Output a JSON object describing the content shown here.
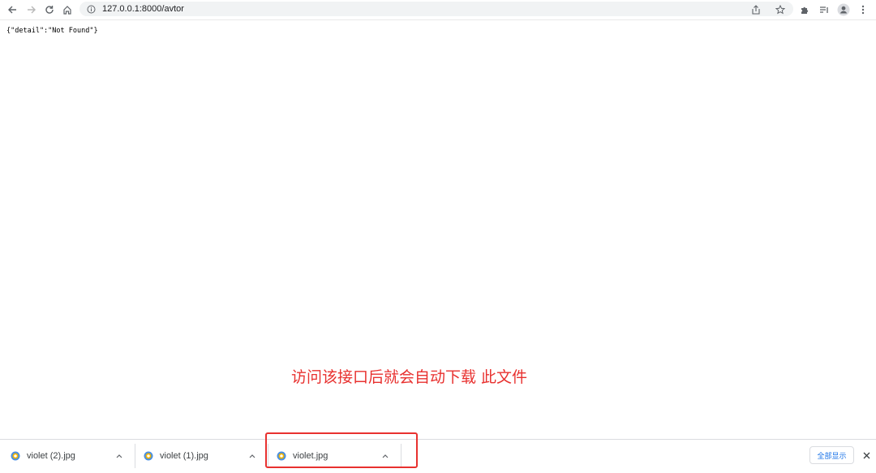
{
  "toolbar": {
    "back_icon": "arrow-left-icon",
    "forward_icon": "arrow-right-icon",
    "reload_icon": "reload-icon",
    "home_icon": "home-icon",
    "url": "127.0.0.1:8000/avtor",
    "right_icons": [
      "share-icon",
      "star-icon",
      "extensions-icon",
      "reading-list-icon",
      "profile-icon",
      "menu-icon"
    ]
  },
  "page": {
    "body_text": "{\"detail\":\"Not Found\"}"
  },
  "annotation": {
    "text": "访问该接口后就会自动下载 此文件",
    "color": "#e8312f"
  },
  "downloads": {
    "items": [
      {
        "filename": "violet (2).jpg"
      },
      {
        "filename": "violet (1).jpg"
      },
      {
        "filename": "violet.jpg"
      }
    ],
    "show_all_label": "全部显示",
    "close_icon": "close-icon"
  },
  "colors": {
    "accent": "#1a73e8",
    "annotation_red": "#e8312f",
    "omnibox_bg": "#f1f3f4"
  }
}
